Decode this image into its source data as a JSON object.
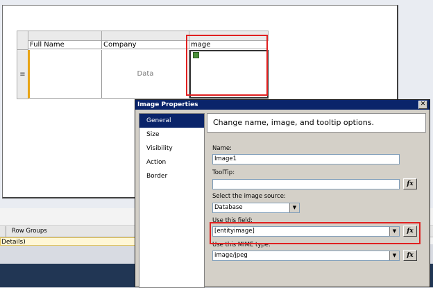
{
  "report": {
    "columns": [
      "Full Name",
      "Company",
      "mage"
    ],
    "data_cells": [
      "",
      "Data",
      ""
    ],
    "row_handle_symbol": "≡"
  },
  "groups": {
    "row_groups_label": "Row Groups",
    "details_label": "Details)"
  },
  "dialog": {
    "title": "Image Properties",
    "close_symbol": "✕",
    "nav_items": [
      {
        "label": "General",
        "active": true
      },
      {
        "label": "Size",
        "active": false
      },
      {
        "label": "Visibility",
        "active": false
      },
      {
        "label": "Action",
        "active": false
      },
      {
        "label": "Border",
        "active": false
      }
    ],
    "banner": "Change name, image, and tooltip options.",
    "name_label": "Name:",
    "name_value": "Image1",
    "tooltip_label": "ToolTip:",
    "tooltip_value": "",
    "source_label": "Select the image source:",
    "source_value": "Database",
    "field_label": "Use this field:",
    "field_value": "[entityimage]",
    "mime_label": "Use this MIME type:",
    "mime_value": "image/jpeg",
    "fx_label": "fx",
    "dropdown_symbol": "▼"
  },
  "colors": {
    "highlight_red": "#e02020",
    "title_bar": "#0a246a",
    "taskbar": "#213654"
  }
}
